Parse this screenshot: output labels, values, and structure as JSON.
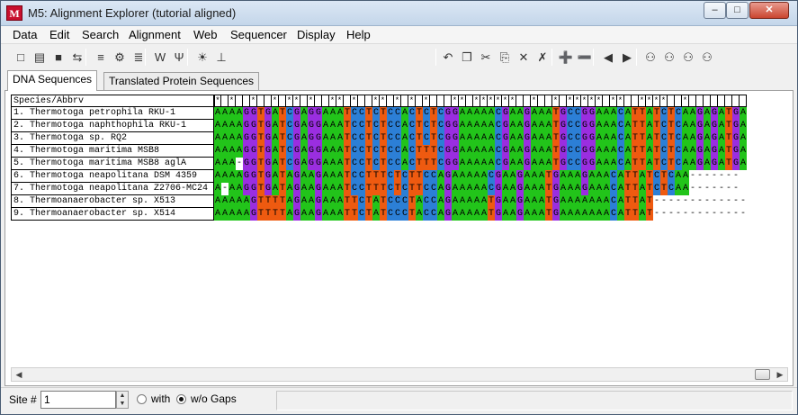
{
  "window": {
    "title": "M5: Alignment Explorer (tutorial aligned)",
    "app_icon": "M",
    "controls": {
      "minimize": "–",
      "maximize": "□",
      "close": "✕"
    }
  },
  "menu": [
    "Data",
    "Edit",
    "Search",
    "Alignment",
    "Web",
    "Sequencer",
    "Display",
    "Help"
  ],
  "toolbar": {
    "left": [
      {
        "name": "new-icon",
        "glyph": "□"
      },
      {
        "name": "open-icon",
        "glyph": "▤"
      },
      {
        "name": "save-icon",
        "glyph": "■"
      },
      {
        "name": "translate-icon",
        "glyph": "⇆"
      },
      {
        "name": "align-clustal-icon",
        "glyph": "≡"
      },
      {
        "name": "align-muscle-icon",
        "glyph": "⚙"
      },
      {
        "name": "sequences-icon",
        "glyph": "≣"
      },
      {
        "name": "web-icon",
        "glyph": "W"
      },
      {
        "name": "muscle-icon",
        "glyph": "Ψ"
      },
      {
        "name": "mark-site-icon",
        "glyph": "☀"
      },
      {
        "name": "unmark-site-icon",
        "glyph": "⊥"
      }
    ],
    "right": [
      {
        "name": "undo-icon",
        "glyph": "↶"
      },
      {
        "name": "copy-icon",
        "glyph": "❐"
      },
      {
        "name": "cut-icon",
        "glyph": "✂"
      },
      {
        "name": "paste-icon",
        "glyph": "⎘"
      },
      {
        "name": "delete-icon",
        "glyph": "✕"
      },
      {
        "name": "delete-gap-icon",
        "glyph": "✗"
      },
      {
        "name": "insert-row-icon",
        "glyph": "➕"
      },
      {
        "name": "delete-row-icon",
        "glyph": "➖"
      },
      {
        "name": "move-left-icon",
        "glyph": "◀"
      },
      {
        "name": "move-right-icon",
        "glyph": "▶"
      },
      {
        "name": "find-icon",
        "glyph": "⚇"
      },
      {
        "name": "find-previous-icon",
        "glyph": "⚇"
      },
      {
        "name": "find-next-icon",
        "glyph": "⚇"
      },
      {
        "name": "find-motif-icon",
        "glyph": "⚇"
      }
    ]
  },
  "tabs": [
    "DNA Sequences",
    "Translated Protein Sequences"
  ],
  "alignment": {
    "header": "Species/Abbrv",
    "consensus": "* *  *  * ** *  ** *  ** * * *   ** ******  *  * ***** **  ****  *",
    "sequences": [
      {
        "name": "1. Thermotoga petrophila RKU-1",
        "seq": "AAAAGGTGATCGAGGAAATCCTCTCCACTCTCGGAAAAACGAAGAAATGCCGGAAACATTATCTCAAGAGATGA"
      },
      {
        "name": "2. Thermotoga naphthophila RKU-1",
        "seq": "AAAAGGTGATCGAGGAAATCCTCTCCACTCTCGGAAAAACGAAGAAATGCCGGAAACATTATCTCAAGAGATGA"
      },
      {
        "name": "3. Thermotoga sp. RQ2",
        "seq": "AAAAGGTGATCGAGGAAATCCTCTCCACTCTCGGAAAAACGAAGAAATGCCGGAAACATTATCTCAAGAGATGA"
      },
      {
        "name": "4. Thermotoga maritima MSB8",
        "seq": "AAAAGGTGATCGAGGAAATCCTCTCCACTTTCGGAAAAACGAAGAAATGCCGGAAACATTATCTCAAGAGATGA"
      },
      {
        "name": "5. Thermotoga maritima MSB8 aglA",
        "seq": "AAA-GGTGATCGAGGAAATCCTCTCCACTTTCGGAAAAACGAAGAAATGCCGGAAACATTATCTCAAGAGATGA"
      },
      {
        "name": "6. Thermotoga neapolitana DSM 4359",
        "seq": "AAAAGGTGATAGAAGAAATCCTTTCTCTTCCAGAAAAACGAAGAAATGAAAGAAACATTATCTCAA-------"
      },
      {
        "name": "7. Thermotoga neapolitana Z2706-MC24",
        "seq": "A-AAGGTGATAGAAGAAATCCTTTCTCTTCCAGAAAAACGAAGAAATGAAAGAAACATTATCTCAA-------"
      },
      {
        "name": "8. Thermoanaerobacter sp. X513",
        "seq": "AAAAAGTTTTAGAAGAAATTCTATCCCTACCAGAAAAATGAAGAAATGAAAAAAACATTAT-------------"
      },
      {
        "name": "9. Thermoanaerobacter sp. X514",
        "seq": "AAAAAGTTTTAGAAGAAATTCTATCCCTACCAGAAAAATGAAGAAATGAAAAAAACATTAT-------------"
      }
    ]
  },
  "status": {
    "site_label": "Site #",
    "site_value": "1",
    "with_gaps_label": "with",
    "without_gaps_label": "w/o Gaps",
    "selected_option": "w/o Gaps"
  },
  "colors": {
    "A": "#22c41a",
    "C": "#2c7fd6",
    "G": "#9a2ee0",
    "T": "#ee5a10"
  }
}
